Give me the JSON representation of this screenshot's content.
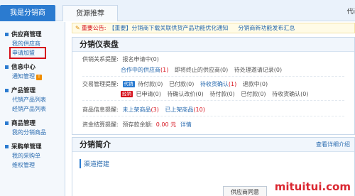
{
  "tabs": [
    {
      "label": "我是分销商"
    },
    {
      "label": "货源推荐"
    }
  ],
  "top_right": "代i",
  "sidebar": [
    {
      "title": "供应商管理",
      "items": [
        {
          "label": "我的供应商"
        },
        {
          "label": "申请加盟"
        }
      ]
    },
    {
      "title": "信息中心",
      "items": [
        {
          "label": "通知管理"
        }
      ]
    },
    {
      "title": "产品管理",
      "items": [
        {
          "label": "代销产品列表"
        },
        {
          "label": "经销产品列表"
        }
      ]
    },
    {
      "title": "商品管理",
      "items": [
        {
          "label": "我的分销商品"
        }
      ]
    },
    {
      "title": "采购单管理",
      "items": [
        {
          "label": "我的采购单"
        },
        {
          "label": "维权管理"
        }
      ]
    }
  ],
  "notice": {
    "label": "重要公告:",
    "items": [
      "【重要】分销商下载关联供货产品功能优化通知",
      "分销商新功能发布汇总"
    ]
  },
  "dashboard": {
    "title": "分销仪表盘",
    "supply": {
      "label": "供销关系提醒:",
      "line1": "报名申请中(0)",
      "line2_a": "合作中的供应商",
      "line2_a_count": "(1)",
      "line2_b": "即将终止的供应商(0)",
      "line2_c": "待处理邀请记录(0)"
    },
    "trade": {
      "label": "交易管理提醒:",
      "tag1": "代销",
      "tag2": "经销",
      "row1": [
        "待付款(0)",
        "已付款(0)"
      ],
      "row1_link": "待收货确认",
      "row1_link_count": "(1)",
      "row1_end": "退款中(0)",
      "row2": [
        "已申请(0)",
        "待确认改价(0)",
        "待付款(0)",
        "已付款(0)",
        "待收货确认(0)"
      ]
    },
    "product": {
      "label": "商品信息提醒:",
      "a": "未上架商品",
      "a_count": "(3)",
      "b": "已上架商品",
      "b_count": "(10)"
    },
    "funds": {
      "label": "资金结算提醒:",
      "text": "预存款余额:",
      "amount": "0.00 元",
      "link": "详情"
    }
  },
  "intro": {
    "title": "分销简介",
    "more": "查看详细介绍",
    "channel": "渠道搭建",
    "supplier_button": "供应商同意"
  },
  "watermark": "mituitui.com"
}
